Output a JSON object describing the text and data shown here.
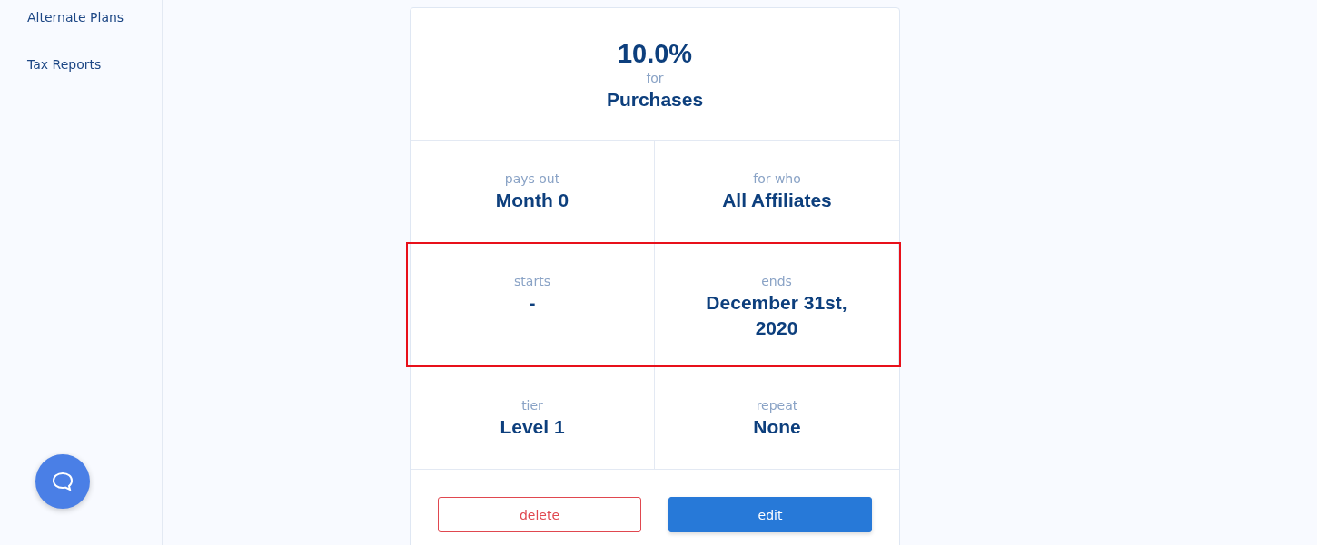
{
  "sidebar": {
    "items": [
      {
        "label": "Alternate Plans"
      },
      {
        "label": "Tax Reports"
      }
    ]
  },
  "card": {
    "rate": "10.0%",
    "connector": "for",
    "target": "Purchases",
    "rows": [
      {
        "highlighted": false,
        "cells": [
          {
            "label": "pays out",
            "value": "Month 0"
          },
          {
            "label": "for who",
            "value": "All Affiliates"
          }
        ]
      },
      {
        "highlighted": true,
        "cells": [
          {
            "label": "starts",
            "value": "-"
          },
          {
            "label": "ends",
            "value": "December 31st, 2020"
          }
        ]
      },
      {
        "highlighted": false,
        "cells": [
          {
            "label": "tier",
            "value": "Level 1"
          },
          {
            "label": "repeat",
            "value": "None"
          }
        ]
      }
    ],
    "buttons": [
      {
        "kind": "danger",
        "label": "delete"
      },
      {
        "kind": "primary",
        "label": "edit"
      }
    ]
  }
}
